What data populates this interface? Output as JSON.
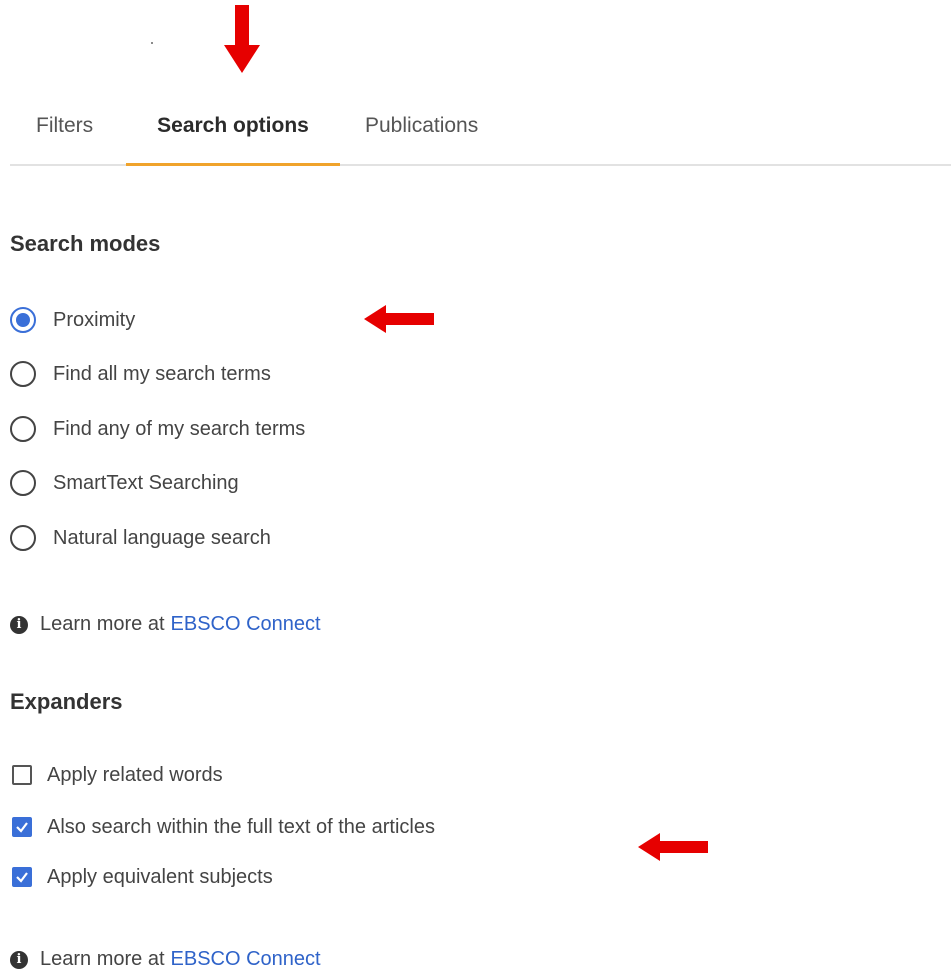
{
  "tabs": [
    {
      "label": "Filters",
      "active": false
    },
    {
      "label": "Search options",
      "active": true
    },
    {
      "label": "Publications",
      "active": false
    }
  ],
  "search_modes": {
    "heading": "Search modes",
    "options": [
      {
        "label": "Proximity",
        "selected": true
      },
      {
        "label": "Find all my search terms",
        "selected": false
      },
      {
        "label": "Find any of my search terms",
        "selected": false
      },
      {
        "label": "SmartText Searching",
        "selected": false
      },
      {
        "label": "Natural language search",
        "selected": false
      }
    ],
    "learn_more": {
      "text": "Learn more at",
      "link": "EBSCO Connect"
    }
  },
  "expanders": {
    "heading": "Expanders",
    "options": [
      {
        "label": "Apply related words",
        "checked": false
      },
      {
        "label": "Also search within the full text of the articles",
        "checked": true
      },
      {
        "label": "Apply equivalent subjects",
        "checked": true
      }
    ],
    "learn_more": {
      "text": "Learn more at",
      "link": "EBSCO Connect"
    }
  },
  "colors": {
    "accent_blue": "#3a6fd8",
    "tab_underline": "#f0a32b",
    "link": "#2f63c9",
    "annotation_arrow": "#e60000"
  },
  "icons": {
    "info": "info-circle-icon",
    "arrow": "red-arrow-icon"
  }
}
